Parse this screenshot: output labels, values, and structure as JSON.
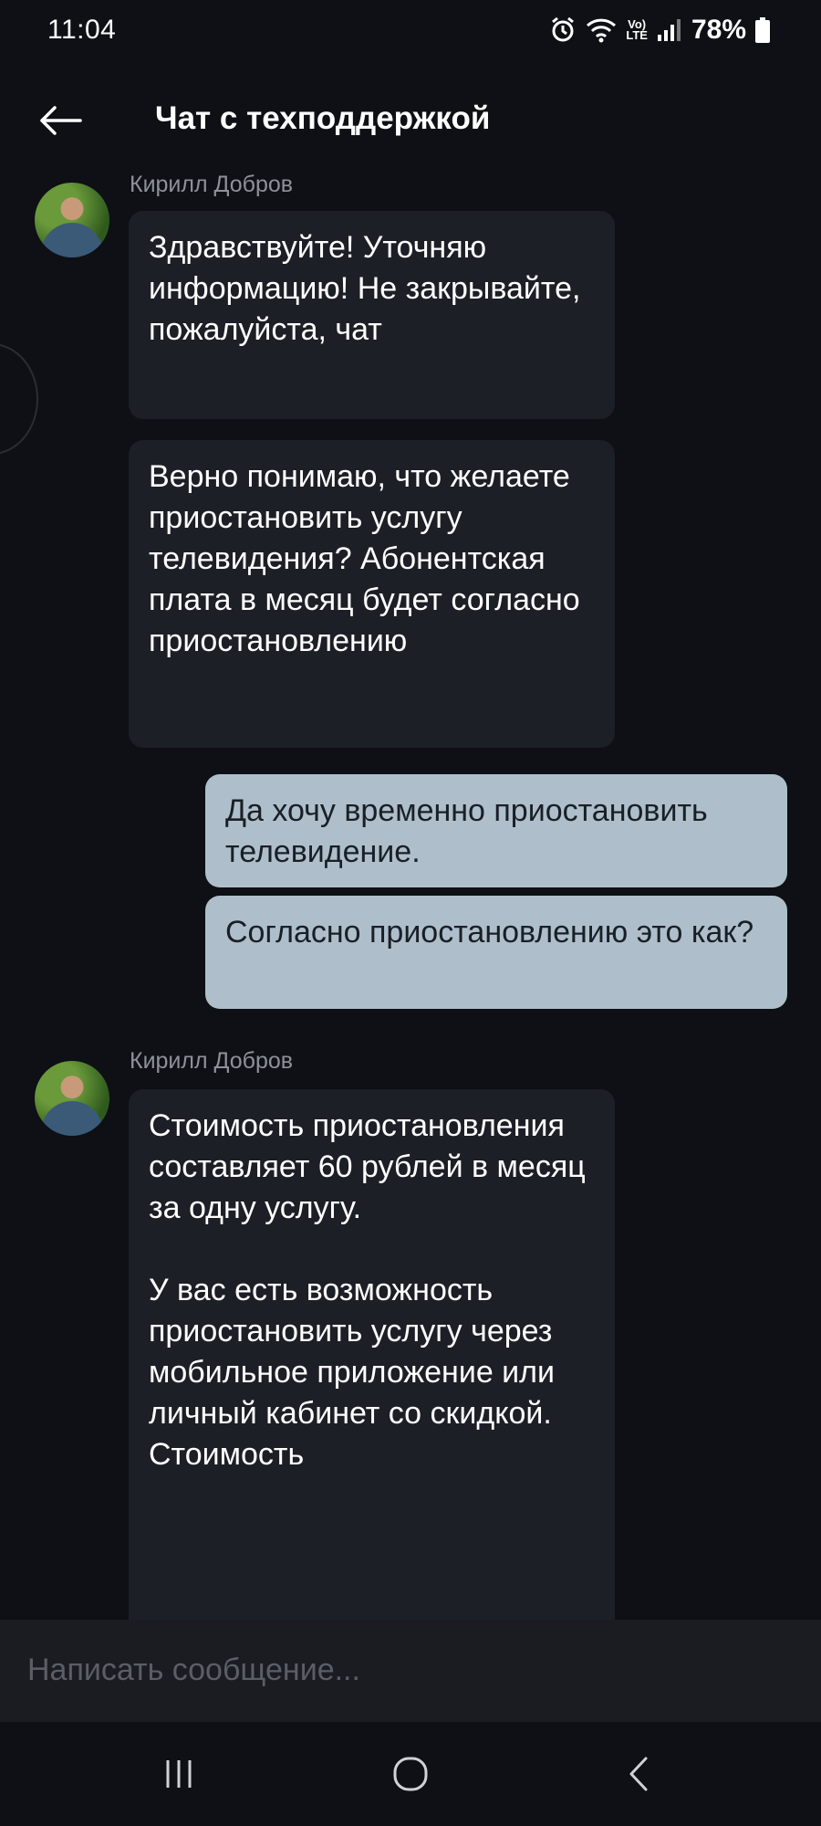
{
  "status": {
    "time": "11:04",
    "lte_top": "Vo)",
    "lte_bottom": "LTE",
    "battery": "78%"
  },
  "header": {
    "title": "Чат с техподдержкой"
  },
  "messages": [
    {
      "sender": "Кирилл Добров",
      "text": "Здравствуйте! Уточняю информацию! Не закрывайте, пожалуйста, чат"
    },
    {
      "text": "Верно понимаю, что желаете приостановить услугу телевидения? Абонентская плата в месяц будет согласно приостановлению"
    },
    {
      "text": "Да хочу временно приостановить телевидение."
    },
    {
      "text": "Согласно приостановлению это как?"
    },
    {
      "sender": "Кирилл Добров",
      "text": "Стоимость приостановления составляет 60 рублей в месяц за одну услугу.\n\nУ вас есть возможность приостановить услугу через мобильное приложение или личный кабинет со скидкой. Стоимость"
    }
  ],
  "composer": {
    "placeholder": "Написать сообщение..."
  }
}
